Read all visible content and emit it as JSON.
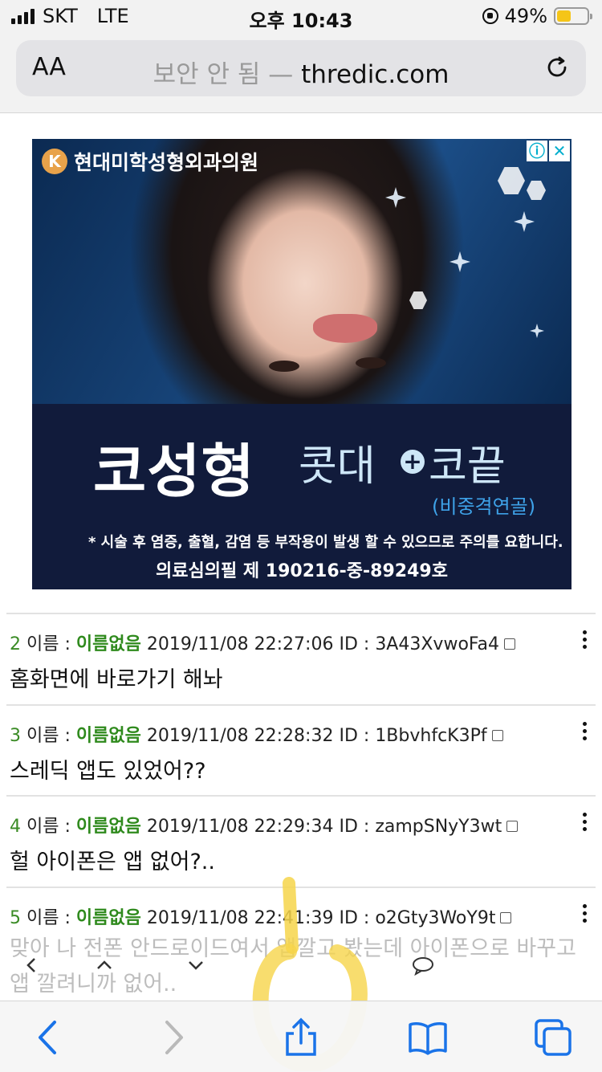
{
  "status_bar": {
    "carrier": "SKT",
    "network": "LTE",
    "time": "오후 10:43",
    "battery": "49%",
    "battery_level": 0.49
  },
  "address_bar": {
    "text_size_label": "AA",
    "security_warning": "보안 안 됨 —",
    "host": "thredic.com"
  },
  "ad": {
    "brand": "현대미학성형외과의원",
    "logo_glyph": "K",
    "info_icon": "ⓘ",
    "close_icon": "✕",
    "headline": "코성형",
    "sub_left": "콧대",
    "plus": "+",
    "sub_right": "코끝",
    "sub_note": "(비중격연골)",
    "warning": "* 시술 후 염증, 출혈, 감염 등 부작용이 발생 할 수  있으므로 주의를 요합니다.",
    "permit": "의료심의필 제 190216-중-89249호"
  },
  "posts": [
    {
      "num": "2",
      "name_label": "이름 :",
      "name": "이름없음",
      "datetime": "2019/11/08 22:27:06",
      "id_label": "ID :",
      "id": "3A43XvwoFa4",
      "body": "홈화면에 바로가기 해놔"
    },
    {
      "num": "3",
      "name_label": "이름 :",
      "name": "이름없음",
      "datetime": "2019/11/08 22:28:32",
      "id_label": "ID :",
      "id": "1BbvhfcK3Pf",
      "body": "스레딕 앱도 있었어??"
    },
    {
      "num": "4",
      "name_label": "이름 :",
      "name": "이름없음",
      "datetime": "2019/11/08 22:29:34",
      "id_label": "ID :",
      "id": "zampSNyY3wt",
      "body": "헐 아이폰은 앱 없어?.."
    },
    {
      "num": "5",
      "name_label": "이름 :",
      "name": "이름없음",
      "datetime": "2019/11/08 22:41:39",
      "id_label": "ID :",
      "id": "o2Gty3WoY9t",
      "body": "맞아 나 전폰 안드로이드여서 앱깔고 봤는데 아이폰으로 바꾸고 앱 깔려니까 없어.."
    }
  ],
  "floating_nav": {
    "prev": "‹",
    "up": "⌃",
    "down": "⌄",
    "comment_icon": "comment-icon"
  },
  "toolbar": {
    "back_icon": "back-icon",
    "forward_icon": "forward-icon",
    "share_icon": "share-icon",
    "bookmarks_icon": "bookmarks-icon",
    "tabs_icon": "tabs-icon"
  },
  "colors": {
    "safari_blue": "#1a73e8",
    "name_green": "#2f8a1d",
    "battery_yellow": "#f5c518",
    "overlay_yellow": "#f6d54a"
  }
}
